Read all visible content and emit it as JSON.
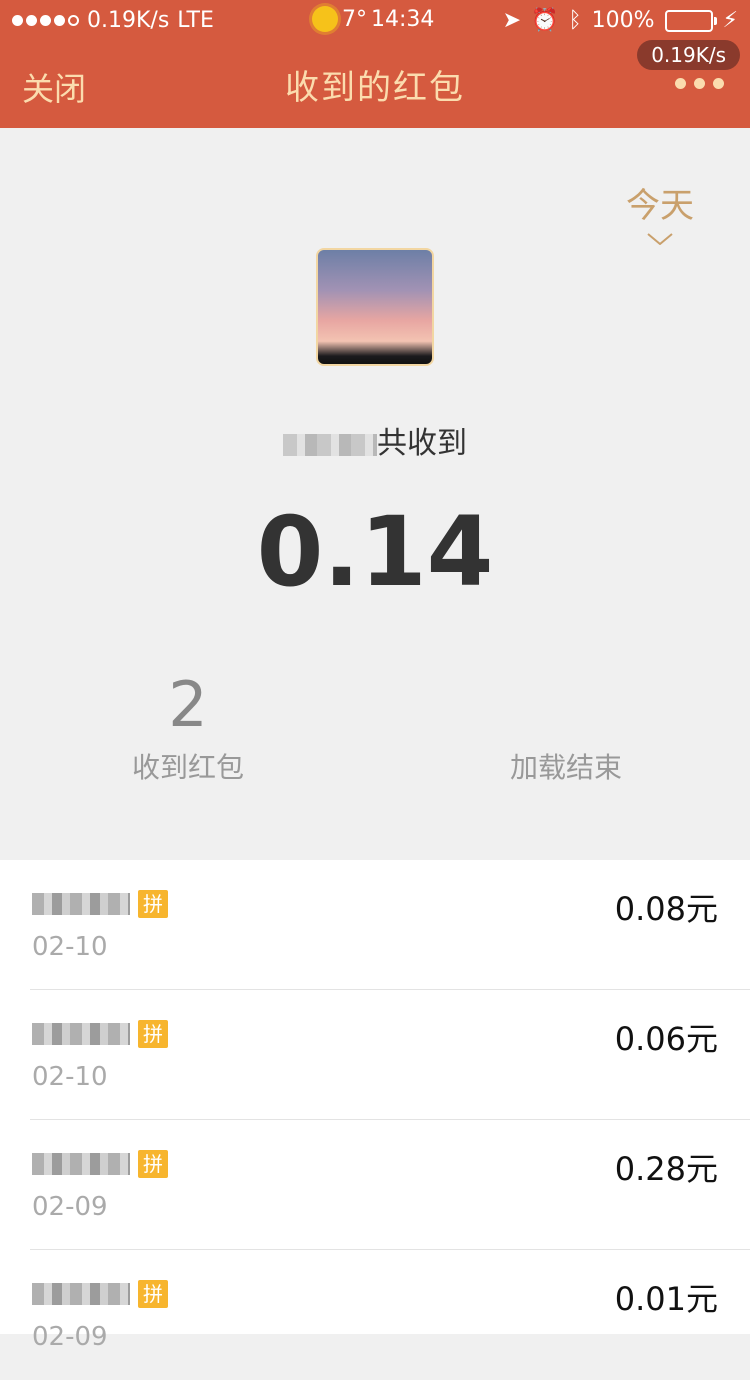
{
  "status_bar": {
    "speed": "0.19K/s",
    "network": "LTE",
    "weather": "7°",
    "time": "14:34",
    "battery": "100%"
  },
  "header": {
    "close_label": "关闭",
    "title": "收到的红包",
    "speed_pill": "0.19K/s"
  },
  "summary": {
    "year_filter": "今天",
    "received_suffix": "共收到",
    "total": "0.14",
    "count": "2",
    "count_label": "收到红包",
    "load_status": "加载结束"
  },
  "list": [
    {
      "tag": "拼",
      "date": "02-10",
      "amount": "0.08元"
    },
    {
      "tag": "拼",
      "date": "02-10",
      "amount": "0.06元"
    },
    {
      "tag": "拼",
      "date": "02-09",
      "amount": "0.28元"
    },
    {
      "tag": "拼",
      "date": "02-09",
      "amount": "0.01元"
    }
  ],
  "colors": {
    "header_bg": "#d55a3f",
    "header_text": "#fbdcae",
    "accent": "#c9a06c",
    "tag": "#f7b52e"
  }
}
